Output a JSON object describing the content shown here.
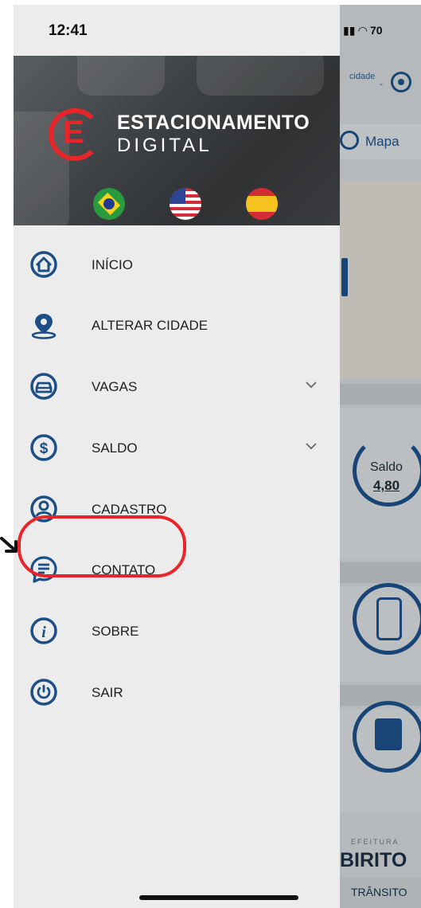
{
  "status_bar": {
    "time": "12:41",
    "battery": "70"
  },
  "header": {
    "brand_line1": "ESTACIONAMENTO",
    "brand_line2": "DIGITAL",
    "logo_letter": "E",
    "flags": [
      "brazil-flag-icon",
      "usa-flag-icon",
      "spain-flag-icon"
    ]
  },
  "menu": {
    "items": [
      {
        "label": "INÍCIO",
        "icon": "home-icon"
      },
      {
        "label": "ALTERAR CIDADE",
        "icon": "location-pin-icon"
      },
      {
        "label": "VAGAS",
        "icon": "car-icon",
        "expandable": true
      },
      {
        "label": "SALDO",
        "icon": "dollar-icon",
        "expandable": true
      },
      {
        "label": "CADASTRO",
        "icon": "user-icon"
      },
      {
        "label": "CONTATO",
        "icon": "chat-icon",
        "highlighted": true
      },
      {
        "label": "SOBRE",
        "icon": "info-icon"
      },
      {
        "label": "SAIR",
        "icon": "power-icon"
      }
    ]
  },
  "background_app": {
    "location_label": "cidade",
    "map_button": "Mapa",
    "saldo_label": "Saldo",
    "saldo_value": "4,80",
    "footer_small": "EFEITURA",
    "footer_big": "BIRITO",
    "footer_bar": "TRÂNSITO"
  },
  "colors": {
    "accent": "#1b4f86",
    "highlight": "#e8262a",
    "drawer_bg": "#ececec"
  }
}
